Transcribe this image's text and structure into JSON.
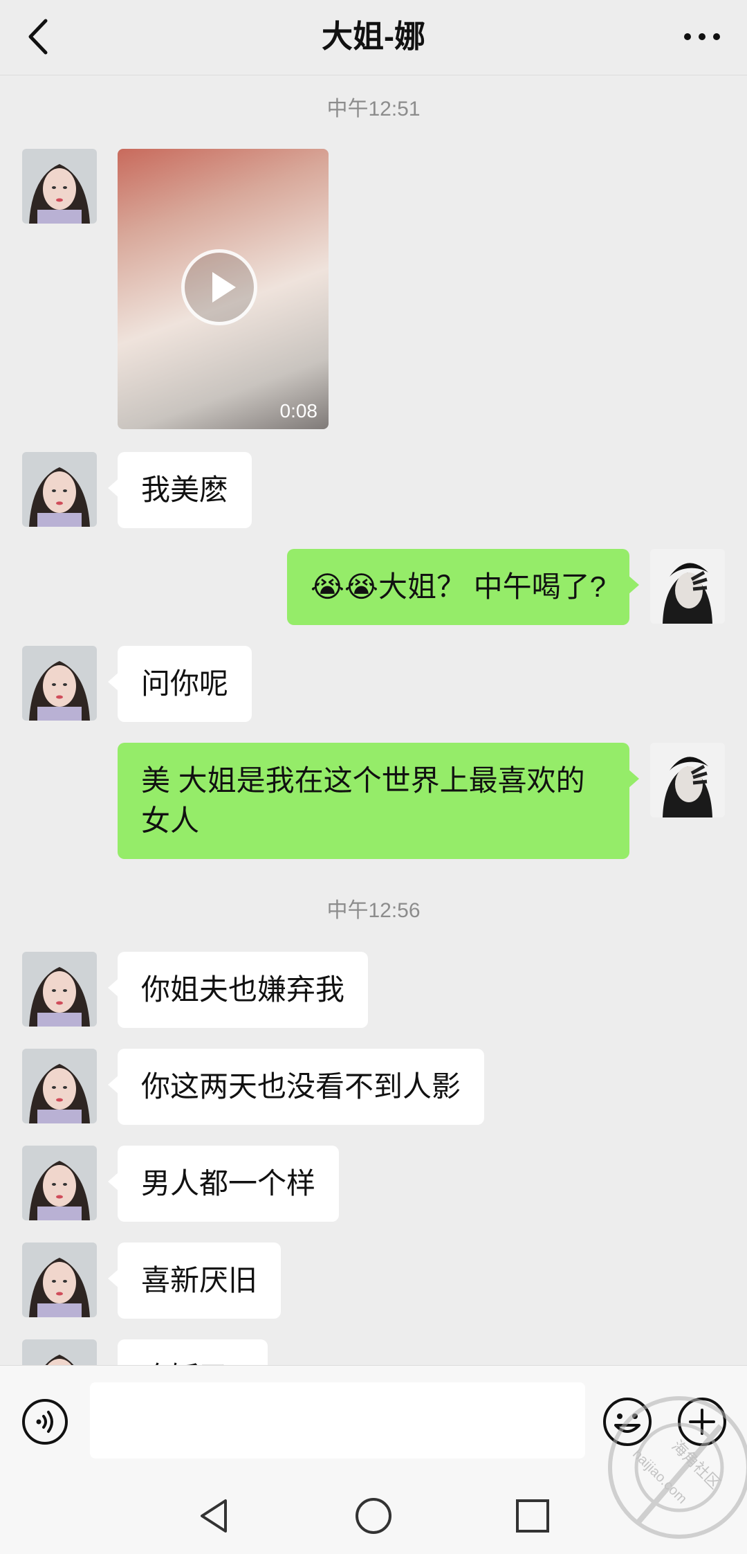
{
  "header": {
    "title": "大姐-娜",
    "back_icon": "chevron-left-icon",
    "more_icon": "more-horizontal-icon"
  },
  "timestamps": [
    "中午12:51",
    "中午12:56"
  ],
  "video_message": {
    "duration": "0:08",
    "icon": "play-icon"
  },
  "messages": [
    {
      "side": "in",
      "text": "我美麽"
    },
    {
      "side": "out",
      "text": "😭😭大姐？ 中午喝了?"
    },
    {
      "side": "in",
      "text": "问你呢"
    },
    {
      "side": "out",
      "text": "美 大姐是我在这个世界上最喜欢的女人"
    },
    {
      "side": "in",
      "text": "你姐夫也嫌弃我"
    },
    {
      "side": "in",
      "text": "你这两天也没看不到人影"
    },
    {
      "side": "in",
      "text": "男人都一个样"
    },
    {
      "side": "in",
      "text": "喜新厌旧"
    },
    {
      "side": "in",
      "text": "吃饭了?"
    }
  ],
  "input_bar": {
    "voice_icon": "voice-icon",
    "emoji_icon": "emoji-icon",
    "plus_icon": "plus-circle-icon",
    "input_value": ""
  },
  "navbar": {
    "back": "nav-back-icon",
    "home": "nav-home-icon",
    "recent": "nav-recent-icon"
  },
  "watermark": {
    "text": "海角社区 haijiao.com"
  },
  "colors": {
    "background": "#ededed",
    "outgoing_bubble": "#95ec69",
    "incoming_bubble": "#ffffff",
    "timestamp": "#8c8c8c"
  }
}
